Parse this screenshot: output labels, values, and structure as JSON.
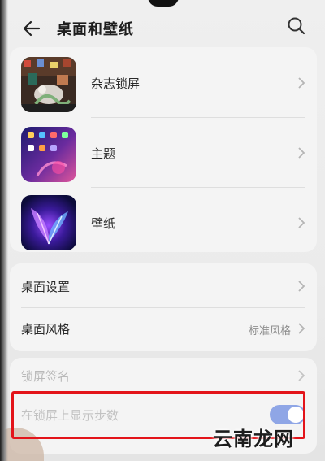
{
  "header": {
    "title": "桌面和壁纸",
    "back_icon": "back-arrow-icon",
    "search_icon": "search-icon"
  },
  "themes": [
    {
      "label": "杂志锁屏",
      "icon": "magazine-lockscreen-thumbnail"
    },
    {
      "label": "主题",
      "icon": "theme-thumbnail"
    },
    {
      "label": "壁纸",
      "icon": "wallpaper-thumbnail"
    }
  ],
  "settings": {
    "desktop_settings": {
      "label": "桌面设置"
    },
    "desktop_style": {
      "label": "桌面风格",
      "value": "标准风格"
    }
  },
  "lockscreen": {
    "signature_label": "锁屏签名",
    "steps_label": "在锁屏上显示步数",
    "steps_enabled": true
  },
  "watermark": "云南龙网",
  "colors": {
    "highlight": "#e3141a",
    "toggle_on": "#8fa6e6",
    "card_bg": "#f4f4f4",
    "page_bg": "#ececec"
  }
}
